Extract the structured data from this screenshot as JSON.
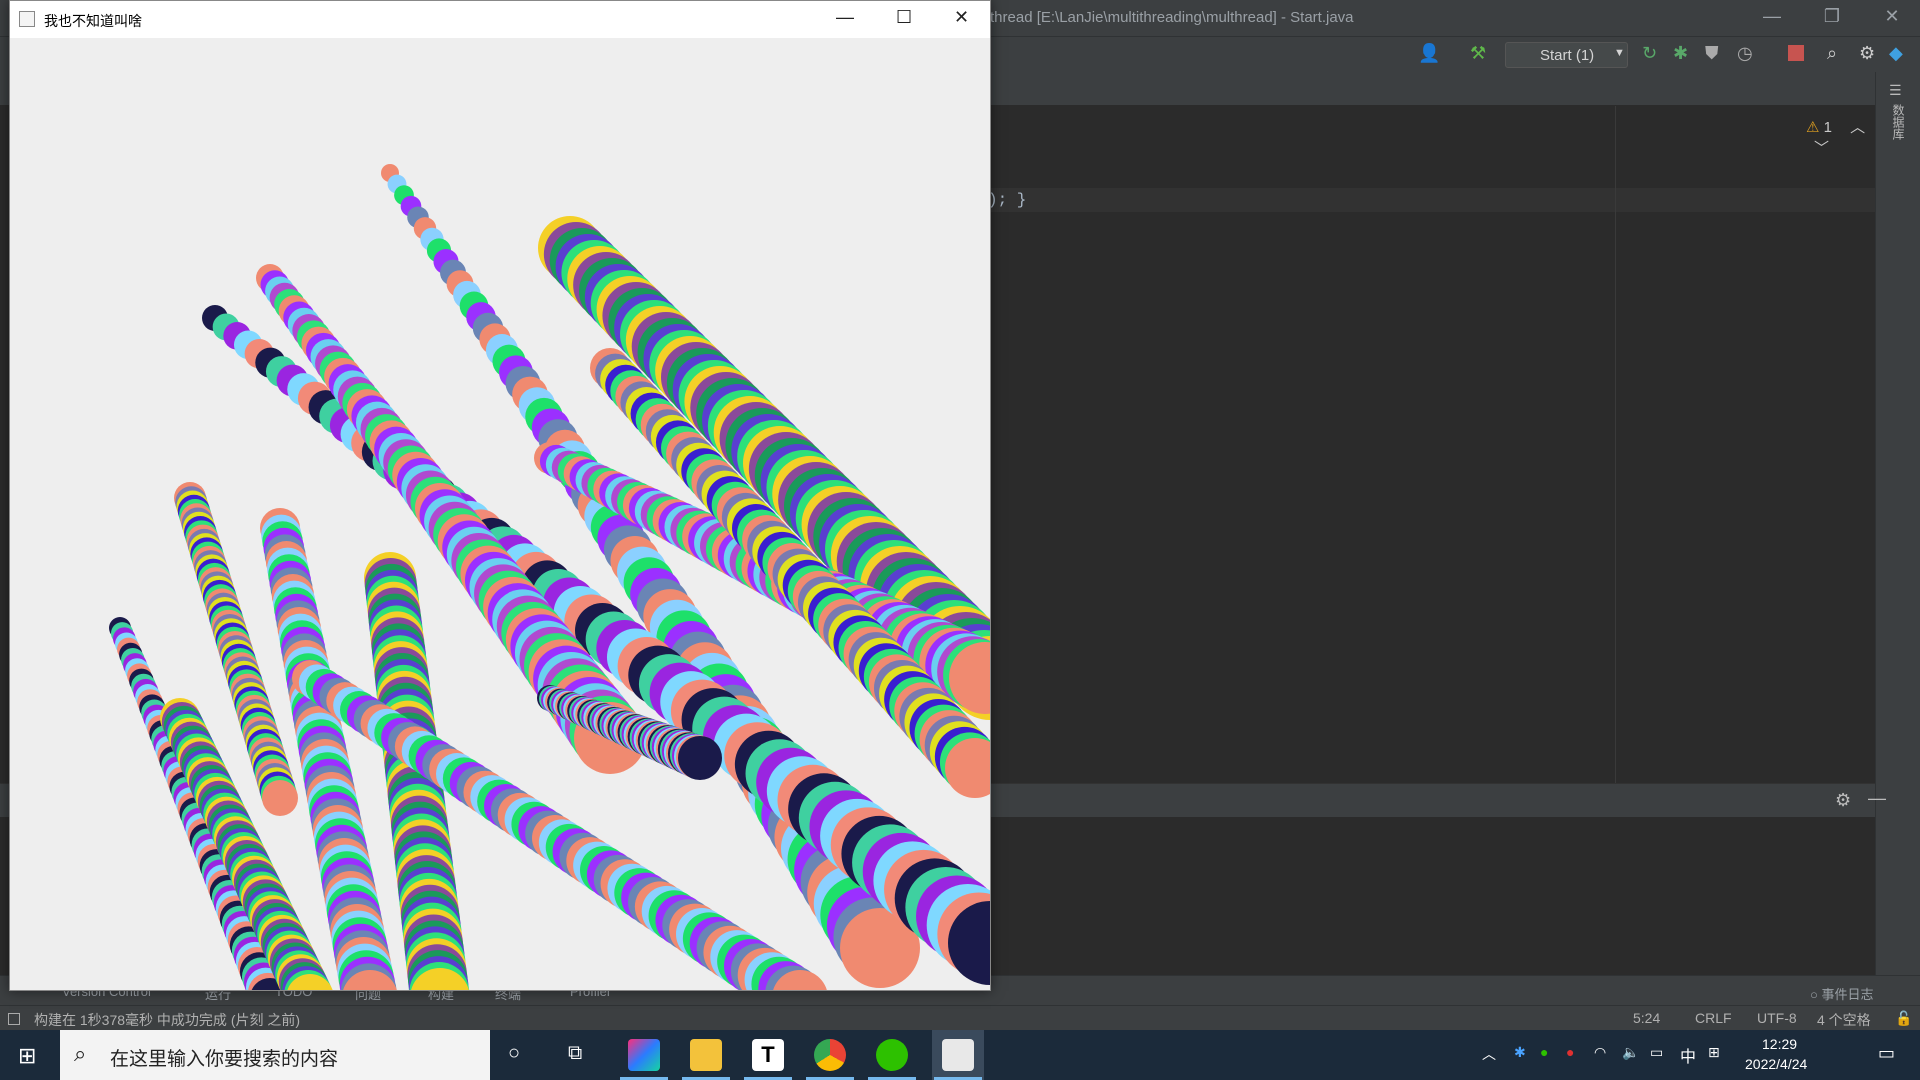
{
  "ide": {
    "window_title": "thread [E:\\LanJie\\multithreading\\multhread] - Start.java",
    "run_config": "Start (1)",
    "code_fragment": "); }",
    "warnings_count": "1",
    "right_strip_label": "数据库",
    "tool_tabs": [
      "Version Control",
      "运行",
      "TODO",
      "问题",
      "构建",
      "终端",
      "Profiler"
    ],
    "event_log": "事件日志",
    "status_message": "构建在 1秒378毫秒 中成功完成 (片刻 之前)",
    "cursor_pos": "5:24",
    "line_sep": "CRLF",
    "encoding": "UTF-8",
    "indent": "4 个空格"
  },
  "app_window": {
    "title": "我也不知道叫啥",
    "strokes": [
      {
        "colors": [
          "#f08a70",
          "#8bd0ff",
          "#1ee06a",
          "#9b30ff",
          "#6a85b5"
        ]
      },
      {
        "colors": [
          "#5a3fd0",
          "#2de07a",
          "#f4d027",
          "#8a4a9a",
          "#1a9a5a"
        ]
      },
      {
        "colors": [
          "#3fd0a0",
          "#9a25e0",
          "#7fd8ff",
          "#f28a78",
          "#1a1a4a"
        ]
      },
      {
        "colors": [
          "#2de07a",
          "#f08a70",
          "#9b30ff",
          "#6ad0f0",
          "#b04ad0"
        ]
      },
      {
        "colors": [
          "#e0e020",
          "#3a1fd0",
          "#2de07a",
          "#f08a70",
          "#7a7ab0"
        ]
      }
    ]
  },
  "taskbar": {
    "search_placeholder": "在这里输入你要搜索的内容",
    "time": "12:29",
    "date": "2022/4/24",
    "ime": "中"
  },
  "colors": {
    "ide_bg": "#2b2b2b",
    "ide_chrome": "#3c3f41",
    "taskbar": "#1b2a3a",
    "canvas_bg": "#eeeeee"
  }
}
